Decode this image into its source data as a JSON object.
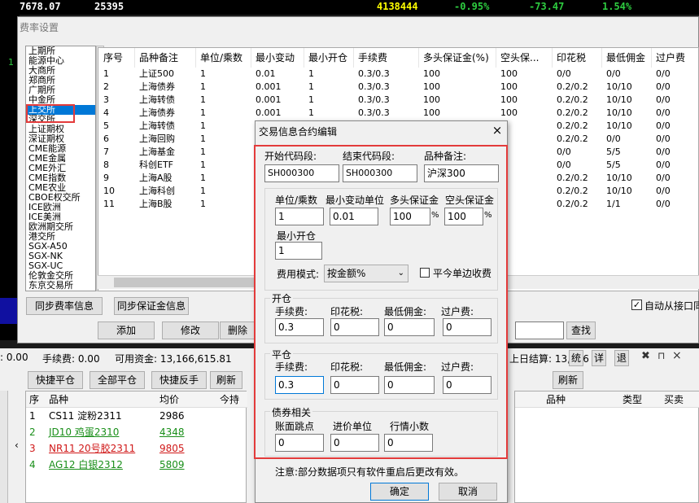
{
  "top_bar": {
    "v1": "7678.07",
    "v2": "25395",
    "v3": "4138444",
    "v4": "-0.95%",
    "v5": "-73.47",
    "v6": "1.54%"
  },
  "left_number": "1",
  "fee_window": {
    "title": "费率设置",
    "categories": [
      "上期所",
      "能源中心",
      "大商所",
      "郑商所",
      "广期所",
      "中金所",
      "上交所",
      "深交所",
      "上证期权",
      "深证期权",
      "CME能源",
      "CME金属",
      "CME外汇",
      "CME指数",
      "CME农业",
      "CBOE权交所",
      "ICE欧洲",
      "ICE美洲",
      "欧洲期交所",
      "港交所",
      "SGX-A50",
      "SGX-NK",
      "SGX-UC",
      "伦敦金交所",
      "东京交易所"
    ],
    "selected_index": 6,
    "columns": [
      "序号",
      "品种备注",
      "单位/乘数",
      "最小变动",
      "最小开仓",
      "手续费",
      "多头保证金(%)",
      "空头保...",
      "印花税",
      "最低佣金",
      "过户费"
    ],
    "rows": [
      [
        "1",
        "上证500",
        "1",
        "0.01",
        "1",
        "0.3/0.3",
        "100",
        "100",
        "0/0",
        "0/0",
        "0/0"
      ],
      [
        "2",
        "上海债券",
        "1",
        "0.001",
        "1",
        "0.3/0.3",
        "100",
        "100",
        "0.2/0.2",
        "10/10",
        "0/0"
      ],
      [
        "3",
        "上海转债",
        "1",
        "0.001",
        "1",
        "0.3/0.3",
        "100",
        "100",
        "0.2/0.2",
        "10/10",
        "0/0"
      ],
      [
        "4",
        "上海债券",
        "1",
        "0.001",
        "1",
        "0.3/0.3",
        "100",
        "100",
        "0.2/0.2",
        "10/10",
        "0/0"
      ],
      [
        "5",
        "上海转债",
        "1",
        "",
        "",
        "",
        "",
        "",
        "0.2/0.2",
        "10/10",
        "0/0"
      ],
      [
        "6",
        "上海回购",
        "1",
        "",
        "",
        "",
        "",
        "",
        "0.2/0.2",
        "0/0",
        "0/0"
      ],
      [
        "7",
        "上海基金",
        "1",
        "",
        "",
        "",
        "",
        "",
        "0/0",
        "5/5",
        "0/0"
      ],
      [
        "8",
        "科创ETF",
        "1",
        "",
        "",
        "",
        "",
        "",
        "0/0",
        "5/5",
        "0/0"
      ],
      [
        "9",
        "上海A股",
        "1",
        "",
        "",
        "",
        "",
        "",
        "0.2/0.2",
        "10/10",
        "0/0"
      ],
      [
        "10",
        "上海科创",
        "1",
        "",
        "",
        "",
        "",
        "",
        "0.2/0.2",
        "10/10",
        "0/0"
      ],
      [
        "11",
        "上海B股",
        "1",
        "",
        "",
        "",
        "",
        "",
        "0.2/0.2",
        "1/1",
        "0/0"
      ]
    ],
    "buttons": {
      "sync_fee": "同步费率信息",
      "sync_margin": "同步保证金信息",
      "add": "添加",
      "modify": "修改",
      "delete": "删除",
      "search": "查找"
    },
    "auto_sync_label": "自动从接口同"
  },
  "lower": {
    "status": {
      "a": ": 0.00",
      "fee": "手续费: 0.00",
      "available": "可用资金: 13,166,615.81",
      "settle": "上日结算: 13,166"
    },
    "mini_buttons": [
      "统",
      "详",
      "退"
    ],
    "buttons": {
      "quick_close": "快捷平仓",
      "close_all": "全部平仓",
      "quick_reverse": "快捷反手",
      "refresh": "刷新",
      "refresh2": "刷新"
    },
    "headers": {
      "seq": "序",
      "variety": "品种",
      "avg": "均价",
      "hold": "今持"
    },
    "rows": [
      {
        "seq": "1",
        "variety": "CS11 淀粉2311",
        "avg": "2986",
        "color": "#000000"
      },
      {
        "seq": "2",
        "variety": "JD10 鸡蛋2310",
        "avg": "4348",
        "color": "#1a8f1a"
      },
      {
        "seq": "3",
        "variety": "NR11 20号胶2311",
        "avg": "9805",
        "color": "#d01818"
      },
      {
        "seq": "4",
        "variety": "AG12 白银2312",
        "avg": "5809",
        "color": "#1a8f1a"
      }
    ],
    "right_headers": {
      "variety": "品种",
      "type": "类型",
      "buysell": "买卖"
    }
  },
  "dialog": {
    "title": "交易信息合约编辑",
    "start_code_label": "开始代码段:",
    "start_code": "SH000300",
    "end_code_label": "结束代码段:",
    "end_code": "SH000300",
    "remark_label": "品种备注:",
    "remark": "沪深300",
    "unit_label": "单位/乘数",
    "unit": "1",
    "tick_label": "最小变动单位",
    "tick": "0.01",
    "long_margin_label": "多头保证金",
    "long_margin": "100",
    "short_margin_label": "空头保证金",
    "short_margin": "100",
    "percent": "%",
    "min_open_label": "最小开仓",
    "min_open": "1",
    "fee_mode_label": "费用模式:",
    "fee_mode": "按金额%",
    "close_today_label": "平今单边收费",
    "open_section": "开仓",
    "close_section": "平仓",
    "fee_label": "手续费:",
    "stamp_label": "印花税:",
    "min_comm_label": "最低佣金:",
    "transfer_label": "过户费:",
    "open": {
      "fee": "0.3",
      "stamp": "0",
      "min_comm": "0",
      "transfer": "0"
    },
    "close": {
      "fee": "0.3",
      "stamp": "0",
      "min_comm": "0",
      "transfer": "0"
    },
    "bond_section": "债券相关",
    "jump_label": "账面跳点",
    "jump": "0",
    "precision_label": "进价单位",
    "precision": "0",
    "decimal_label": "行情小数",
    "decimal": "0",
    "note": "注意:部分数据项只有软件重启后更改有效。",
    "ok": "确定",
    "cancel": "取消"
  }
}
